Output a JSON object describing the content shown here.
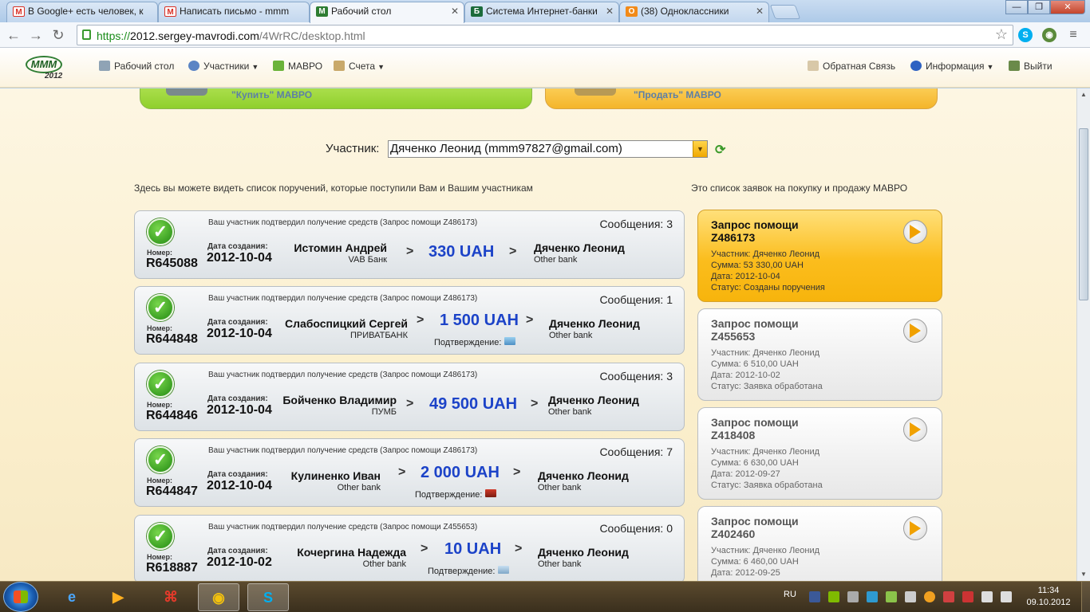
{
  "browser": {
    "tabs": [
      {
        "title": "В Google+ есть человек, к",
        "icon": "gmail-icon",
        "color": "#d93025",
        "active": false
      },
      {
        "title": "Написать письмо - mmm",
        "icon": "gmail-icon",
        "color": "#d93025",
        "active": false
      },
      {
        "title": "Рабочий стол",
        "icon": "mmm-icon",
        "color": "#2e7d32",
        "active": true
      },
      {
        "title": "Система Интернет-банки",
        "icon": "bank-icon",
        "color": "#1b6b3a",
        "active": false
      },
      {
        "title": "(38) Одноклассники",
        "icon": "odnoklassniki-icon",
        "color": "#f28a18",
        "active": false
      }
    ],
    "url_scheme": "https://",
    "url_host": "2012.sergey-mavrodi.com",
    "url_path": "/4WrRC/desktop.html"
  },
  "site_nav": {
    "left": [
      {
        "label": "Рабочий стол",
        "icon": "desktop-icon",
        "dropdown": false
      },
      {
        "label": "Участники",
        "icon": "users-icon",
        "dropdown": true
      },
      {
        "label": "МАВРО",
        "icon": "mavro-icon",
        "dropdown": false
      },
      {
        "label": "Счета",
        "icon": "accounts-icon",
        "dropdown": true
      }
    ],
    "right": [
      {
        "label": "Обратная Связь",
        "icon": "feedback-icon",
        "dropdown": false
      },
      {
        "label": "Информация",
        "icon": "info-icon",
        "dropdown": true
      },
      {
        "label": "Выйти",
        "icon": "logout-icon",
        "dropdown": false
      }
    ]
  },
  "logo": {
    "year": "2012",
    "mark": "MMM"
  },
  "actions": {
    "buy": "\"Купить\" МАВРО",
    "sell": "\"Продать\" МАВРО"
  },
  "participant": {
    "label": "Участник:",
    "value": "Дяченко Леонид (mmm97827@gmail.com)"
  },
  "intro_left": "Здесь вы можете видеть список поручений, которые поступили Вам и Вашим участникам",
  "intro_right": "Это список заявок на покупку и продажу МАВРО",
  "order_labels": {
    "number": "Номер:",
    "created": "Дата создания:",
    "messages": "Сообщения:",
    "proof": "Подтверждение:"
  },
  "orders": [
    {
      "status": "Ваш участник подтвердил получение средств (Запрос помощи Z486173)",
      "messages": "3",
      "number": "R645088",
      "date": "2012-10-04",
      "sender": "Истомин Андрей",
      "sender_bank": "VAB Банк",
      "amount": "330 UAH",
      "receiver": "Дяченко Леонид",
      "receiver_bank": "Other bank",
      "has_proof": false
    },
    {
      "status": "Ваш участник подтвердил получение средств (Запрос помощи Z486173)",
      "messages": "1",
      "number": "R644848",
      "date": "2012-10-04",
      "sender": "Слабоспицкий Сергей",
      "sender_bank": "ПРИВАТБАНК",
      "amount": "1 500 UAH",
      "receiver": "Дяченко Леонид",
      "receiver_bank": "Other bank",
      "has_proof": true
    },
    {
      "status": "Ваш участник подтвердил получение средств (Запрос помощи Z486173)",
      "messages": "3",
      "number": "R644846",
      "date": "2012-10-04",
      "sender": "Бойченко Владимир",
      "sender_bank": "ПУМБ",
      "amount": "49 500 UAH",
      "receiver": "Дяченко Леонид",
      "receiver_bank": "Other bank",
      "has_proof": false
    },
    {
      "status": "Ваш участник подтвердил получение средств (Запрос помощи Z486173)",
      "messages": "7",
      "number": "R644847",
      "date": "2012-10-04",
      "sender": "Кулиненко Иван",
      "sender_bank": "Other bank",
      "amount": "2 000 UAH",
      "receiver": "Дяченко Леонид",
      "receiver_bank": "Other bank",
      "has_proof": true
    },
    {
      "status": "Ваш участник подтвердил получение средств (Запрос помощи Z455653)",
      "messages": "0",
      "number": "R618887",
      "date": "2012-10-02",
      "sender": "Кочергина Надежда",
      "sender_bank": "Other bank",
      "amount": "10 UAH",
      "receiver": "Дяченко Леонид",
      "receiver_bank": "Other bank",
      "has_proof": true
    }
  ],
  "requests": [
    {
      "title": "Запрос помощи",
      "id": "Z486173",
      "participant": "Участник: Дяченко Леонид",
      "sum": "Сумма: 53 330,00 UAH",
      "date": "Дата: 2012-10-04",
      "status": "Статус: Созданы поручения",
      "active": true
    },
    {
      "title": "Запрос помощи",
      "id": "Z455653",
      "participant": "Участник: Дяченко Леонид",
      "sum": "Сумма: 6 510,00 UAH",
      "date": "Дата: 2012-10-02",
      "status": "Статус: Заявка обработана",
      "active": false
    },
    {
      "title": "Запрос помощи",
      "id": "Z418408",
      "participant": "Участник: Дяченко Леонид",
      "sum": "Сумма: 6 630,00 UAH",
      "date": "Дата: 2012-09-27",
      "status": "Статус: Заявка обработана",
      "active": false
    },
    {
      "title": "Запрос помощи",
      "id": "Z402460",
      "participant": "Участник: Дяченко Леонид",
      "sum": "Сумма: 6 460,00 UAH",
      "date": "Дата: 2012-09-25",
      "status": "",
      "active": false
    }
  ],
  "taskbar": {
    "apps": [
      {
        "name": "ie-icon",
        "active": false
      },
      {
        "name": "media-icon",
        "active": false
      },
      {
        "name": "pdf-icon",
        "active": false
      },
      {
        "name": "chrome-icon",
        "active": true
      },
      {
        "name": "skype-icon",
        "active": true
      }
    ],
    "lang": "RU",
    "time": "11:34",
    "date": "09.10.2012"
  },
  "colors": {
    "accent_blue": "#1c43c8",
    "buy_green": "#8fcf2c",
    "sell_orange": "#f4b52a",
    "active_request": "#fbbd1d"
  }
}
